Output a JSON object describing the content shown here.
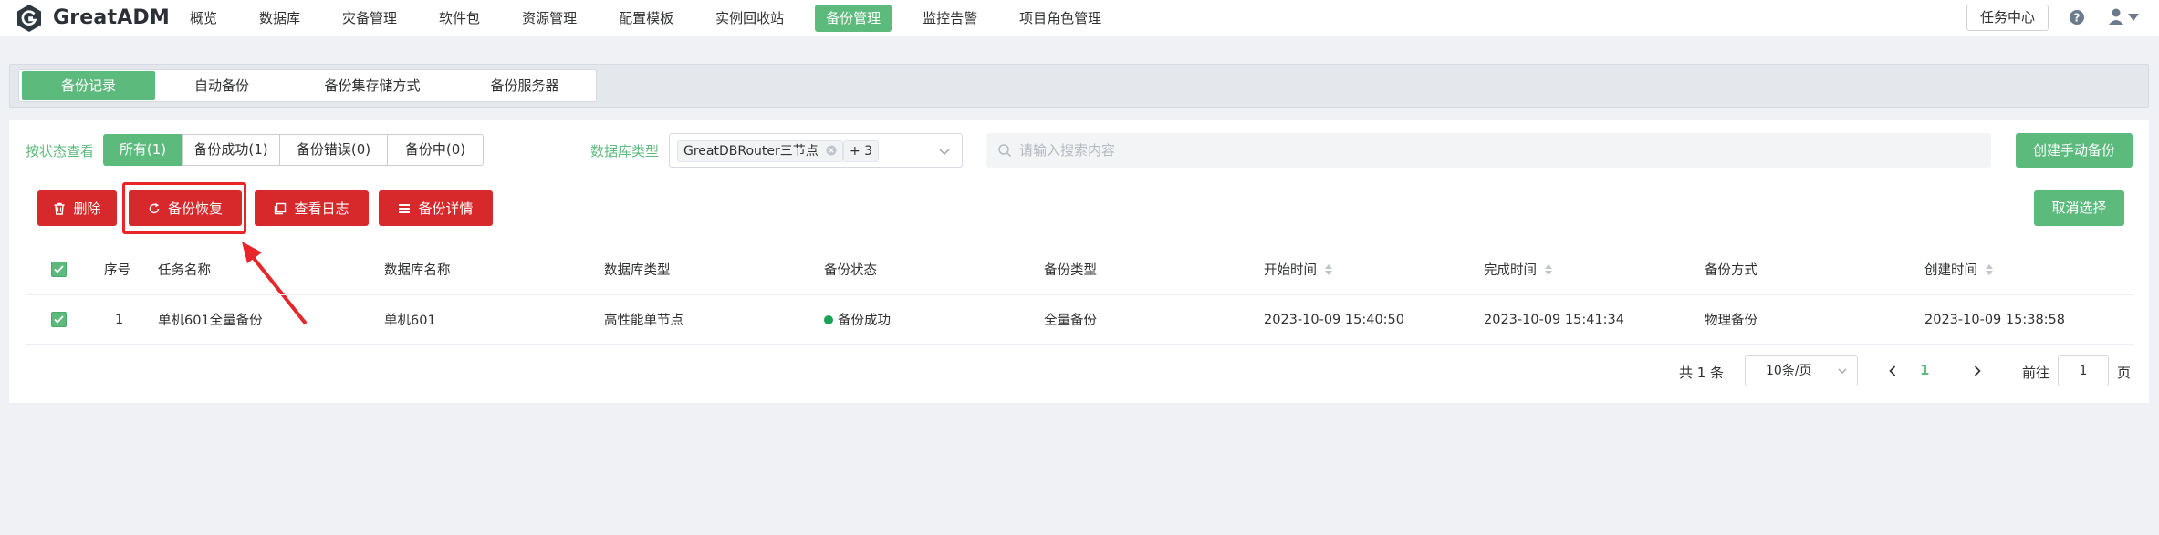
{
  "app": {
    "name": "GreatADM",
    "nav": [
      "概览",
      "数据库",
      "灾备管理",
      "软件包",
      "资源管理",
      "配置模板",
      "实例回收站",
      "备份管理",
      "监控告警",
      "项目角色管理"
    ],
    "active_nav": "备份管理",
    "task_center": "任务中心"
  },
  "subtabs": [
    "备份记录",
    "自动备份",
    "备份集存储方式",
    "备份服务器"
  ],
  "filters": {
    "status_label": "按状态查看",
    "status_options": [
      "所有(1)",
      "备份成功(1)",
      "备份错误(0)",
      "备份中(0)"
    ],
    "db_type_label": "数据库类型",
    "db_type_tag": "GreatDBRouter三节点",
    "db_type_more": "+ 3",
    "search_placeholder": "请输入搜索内容",
    "create_button": "创建手动备份"
  },
  "actions": {
    "delete": "删除",
    "restore": "备份恢复",
    "view_log": "查看日志",
    "details": "备份详情",
    "cancel_select": "取消选择"
  },
  "table": {
    "headers": [
      "序号",
      "任务名称",
      "数据库名称",
      "数据库类型",
      "备份状态",
      "备份类型",
      "开始时间",
      "完成时间",
      "备份方式",
      "创建时间"
    ],
    "rows": [
      {
        "index": "1",
        "task_name": "单机601全量备份",
        "db_name": "单机601",
        "db_type": "高性能单节点",
        "status": "备份成功",
        "backup_type": "全量备份",
        "start_time": "2023-10-09 15:40:50",
        "finish_time": "2023-10-09 15:41:34",
        "method": "物理备份",
        "created_time": "2023-10-09 15:38:58"
      }
    ]
  },
  "pagination": {
    "total": "共 1 条",
    "page_size": "10条/页",
    "current_page": "1",
    "goto_label": "前往",
    "goto_value": "1",
    "page_suffix": "页"
  },
  "colors": {
    "accent": "#5dba7d",
    "danger": "#d7282c",
    "success_dot": "#1aa352"
  }
}
